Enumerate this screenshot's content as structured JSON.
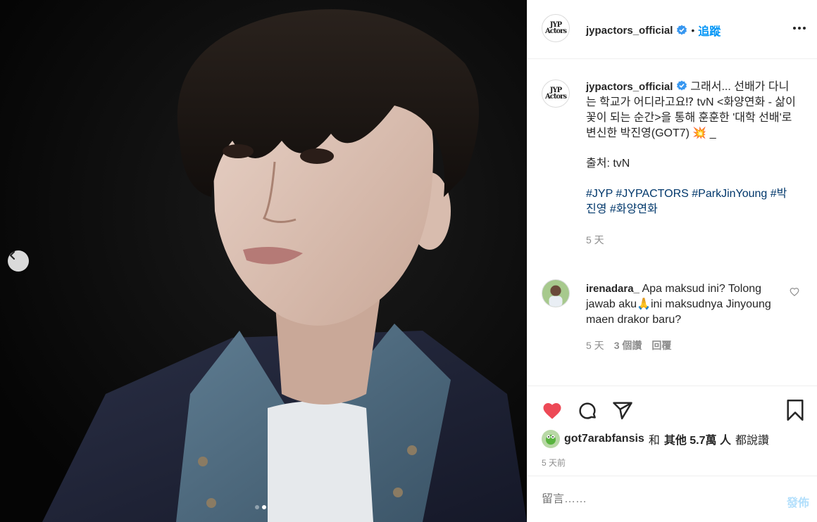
{
  "post": {
    "author": "jypactors_official",
    "follow_label": "追蹤",
    "separator": "•",
    "logo_text": "JYP Actors",
    "caption_text": "그래서... 선배가 다니는 학교가 어디라고요⁉ tvN <화양연화 - 삶이 꽃이 되는 순간>을 통해 훈훈한 '대학 선배'로 변신한 박진영(GOT7) 💥 _",
    "caption_source": "출처: tvN",
    "hashtags": "#JYP #JYPACTORS #ParkJinYoung #박진영 #화양연화",
    "caption_time": "5 天"
  },
  "comment": {
    "user": "irenadara_",
    "text": "Apa maksud ini? Tolong jawab aku🙏ini maksudnya Jinyoung maen drakor baru?",
    "time": "5 天",
    "likes": "3 個讚",
    "reply": "回覆"
  },
  "likes": {
    "user": "got7arabfansis",
    "joiner": "和",
    "others": "其他 5.7萬 人",
    "suffix": "都說讚"
  },
  "post_time": "5 天前",
  "comment_box": {
    "placeholder": "留言……",
    "post_label": "發佈"
  },
  "icons": [
    "verified-icon",
    "more-icon",
    "heart-icon",
    "comment-icon",
    "share-icon",
    "save-icon",
    "chevron-left-icon"
  ],
  "colors": {
    "accent": "#0095f6",
    "like_red": "#ed4956",
    "hashtag": "#00376b"
  },
  "carousel": {
    "count": 2,
    "active_index": 1
  }
}
